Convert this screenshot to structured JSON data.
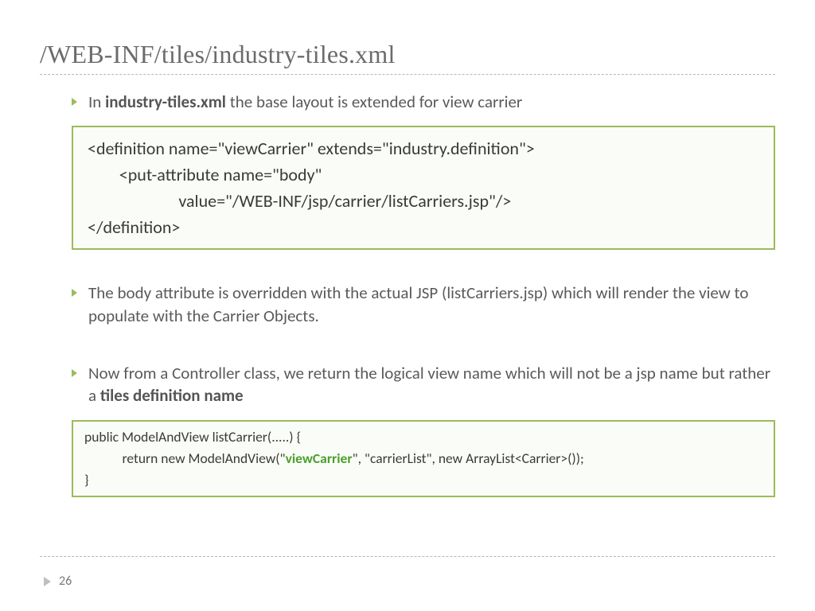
{
  "title": "/WEB-INF/tiles/industry-tiles.xml",
  "bullets": {
    "b1_pre": "In ",
    "b1_bold": "industry-tiles.xml",
    "b1_post": " the base layout is extended for view carrier",
    "b2": "The body attribute is overridden with the actual JSP (listCarriers.jsp) which will render the view to populate with the Carrier Objects.",
    "b3_pre": "Now from a Controller class, we return the logical view name which will not be a jsp name but rather a ",
    "b3_bold": "tiles definition name"
  },
  "code1": {
    "l1": "<definition name=\"viewCarrier\" extends=\"industry.definition\">",
    "l2": "        <put-attribute name=\"body\"",
    "l3": "                       value=\"/WEB-INF/jsp/carrier/listCarriers.jsp\"/>",
    "l4": "</definition>"
  },
  "code2": {
    "l1_a": "public ModelAndView listCarrier(.....) {",
    "l2_a": "            return new ModelAndView(\"",
    "l2_green": "viewCarrier",
    "l2_b": "\", \"carrierList\", new ArrayList<Carrier>());",
    "l3_a": "}"
  },
  "page_number": "26"
}
